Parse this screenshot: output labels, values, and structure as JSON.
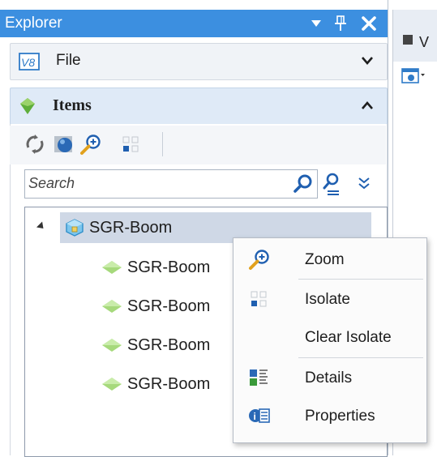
{
  "explorer": {
    "title": "Explorer",
    "sections": {
      "file": {
        "label": "File",
        "icon": "v8-file-icon"
      },
      "items": {
        "label": "Items",
        "icon": "green-gem-icon"
      }
    },
    "toolbar_icons": [
      "refresh-icon",
      "model-sphere-icon",
      "zoom-icon",
      "isolate-icon"
    ],
    "search": {
      "placeholder": "Search",
      "value": ""
    },
    "tree": {
      "root": {
        "label": "SGR-Boom",
        "expanded": true,
        "selected": true
      },
      "children": [
        {
          "label": "SGR-Boom"
        },
        {
          "label": "SGR-Boom"
        },
        {
          "label": "SGR-Boom"
        },
        {
          "label": "SGR-Boom"
        }
      ]
    }
  },
  "context_menu": {
    "items": [
      {
        "label": "Zoom",
        "icon": "zoom-icon"
      },
      {
        "label": "Isolate",
        "icon": "isolate-icon"
      },
      {
        "label": "Clear Isolate",
        "icon": ""
      },
      {
        "label": "Details",
        "icon": "details-icon"
      },
      {
        "label": "Properties",
        "icon": "properties-icon"
      }
    ]
  },
  "second_pane": {
    "tab_text": "V"
  },
  "colors": {
    "titlebar": "#3c8fe0",
    "selection": "#cfd8e6",
    "section_active": "#dfeaf7"
  }
}
